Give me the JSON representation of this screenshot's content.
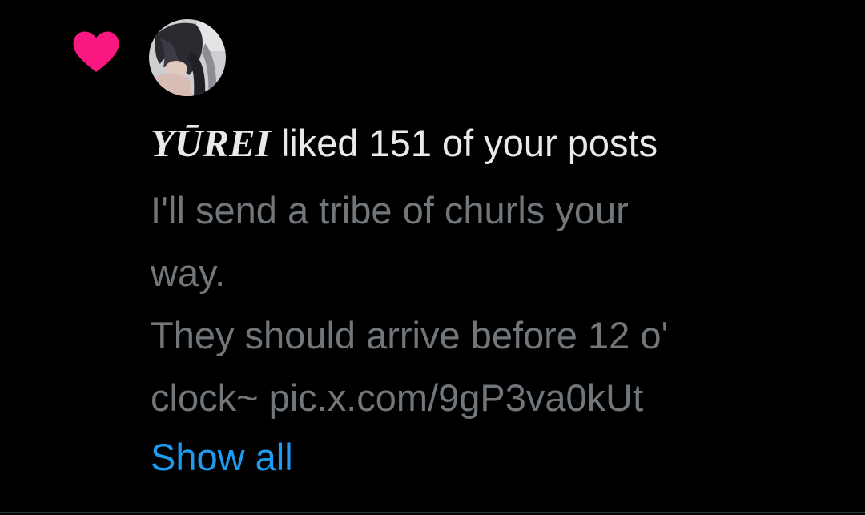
{
  "notification": {
    "icon": "heart-icon",
    "icon_color": "#f91880",
    "avatar": "user-avatar",
    "username": "YŪREI",
    "action_text": " liked 151 of your posts",
    "post_lines": [
      "I'll send a tribe of churls your",
      "way.",
      "They should arrive before 12 o'",
      "clock~ pic.x.com/9gP3va0kUt"
    ],
    "show_all_label": "Show all",
    "link_color": "#1d9bf0",
    "secondary_text_color": "#71767b",
    "background": "#000000"
  }
}
